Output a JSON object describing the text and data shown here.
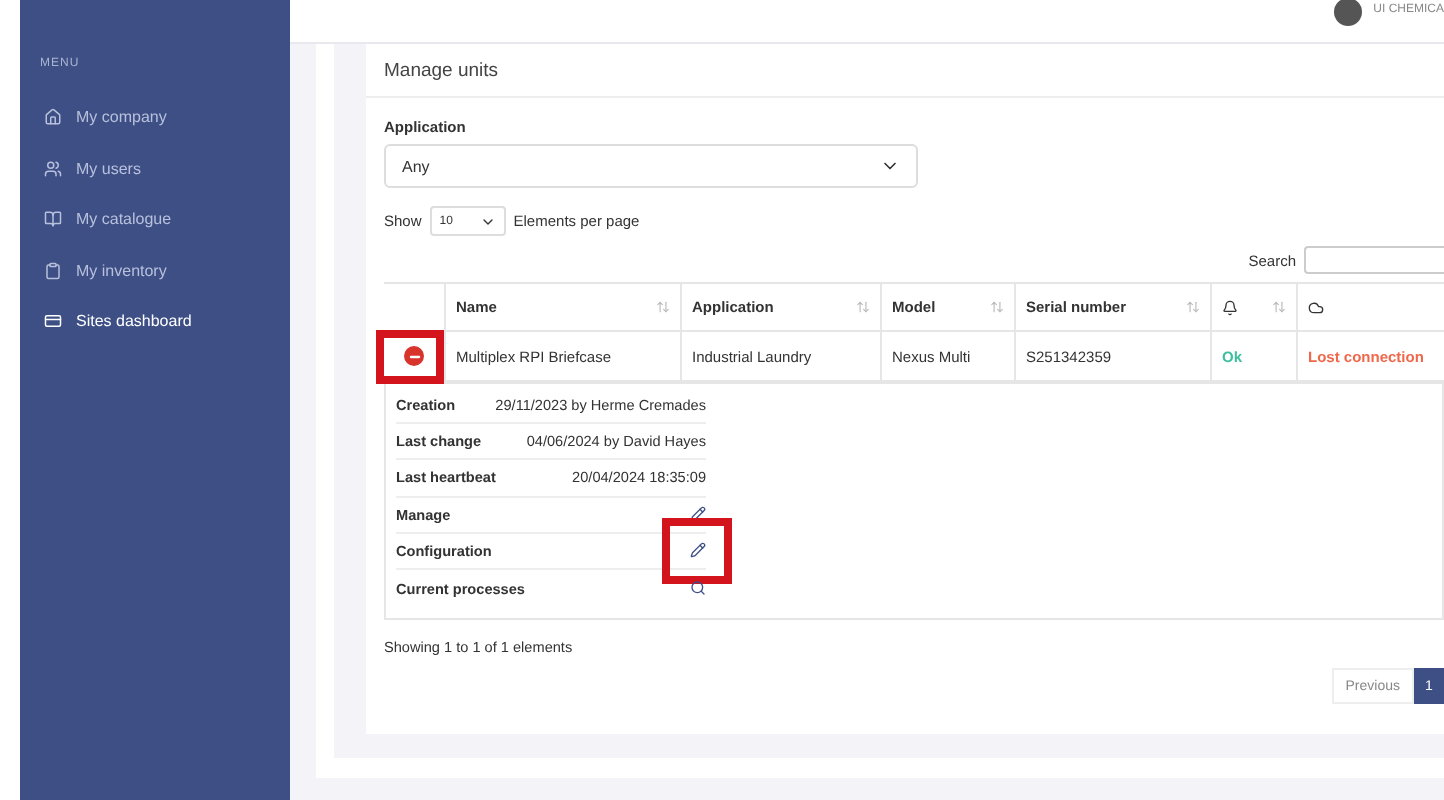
{
  "header": {
    "user_company": "UI CHEMICA"
  },
  "sidebar": {
    "section_label": "MENU",
    "items": [
      {
        "label": "My company",
        "selected": false
      },
      {
        "label": "My users",
        "selected": false
      },
      {
        "label": "My catalogue",
        "selected": false
      },
      {
        "label": "My inventory",
        "selected": false
      },
      {
        "label": "Sites dashboard",
        "selected": true
      }
    ]
  },
  "card": {
    "title": "Manage units",
    "filter": {
      "label": "Application",
      "value": "Any"
    },
    "page_size": {
      "prefix": "Show",
      "value": "10",
      "suffix": "Elements per page"
    },
    "search": {
      "label": "Search"
    },
    "table": {
      "columns": [
        {
          "label": "Name",
          "kind": "text"
        },
        {
          "label": "Application",
          "kind": "text"
        },
        {
          "label": "Model",
          "kind": "text"
        },
        {
          "label": "Serial number",
          "kind": "text"
        },
        {
          "kind": "bell"
        },
        {
          "kind": "cloud"
        }
      ],
      "rows": [
        {
          "expanded": true,
          "cells": [
            "Multiplex RPI Briefcase",
            "Industrial Laundry",
            "Nexus Multi",
            "S251342359"
          ],
          "alarm": {
            "text": "Ok",
            "color": "#3bbf9e"
          },
          "connection": {
            "text": "Lost connection",
            "color": "#f0684c"
          },
          "details": [
            {
              "label": "Creation",
              "value": "29/11/2023 by Herme Cremades",
              "kind": "text"
            },
            {
              "label": "Last change",
              "value": "04/06/2024 by David Hayes",
              "kind": "text"
            },
            {
              "label": "Last heartbeat",
              "value": "20/04/2024 18:35:09",
              "kind": "text"
            },
            {
              "label": "Manage",
              "kind": "edit",
              "highlighted": false
            },
            {
              "label": "Configuration",
              "kind": "edit",
              "highlighted": true
            },
            {
              "label": "Current processes",
              "kind": "search",
              "highlighted": false
            }
          ]
        }
      ]
    },
    "info": "Showing 1 to 1 of 1 elements",
    "pagination": {
      "previous": "Previous",
      "pages": [
        {
          "label": "1",
          "selected": true
        }
      ]
    }
  }
}
